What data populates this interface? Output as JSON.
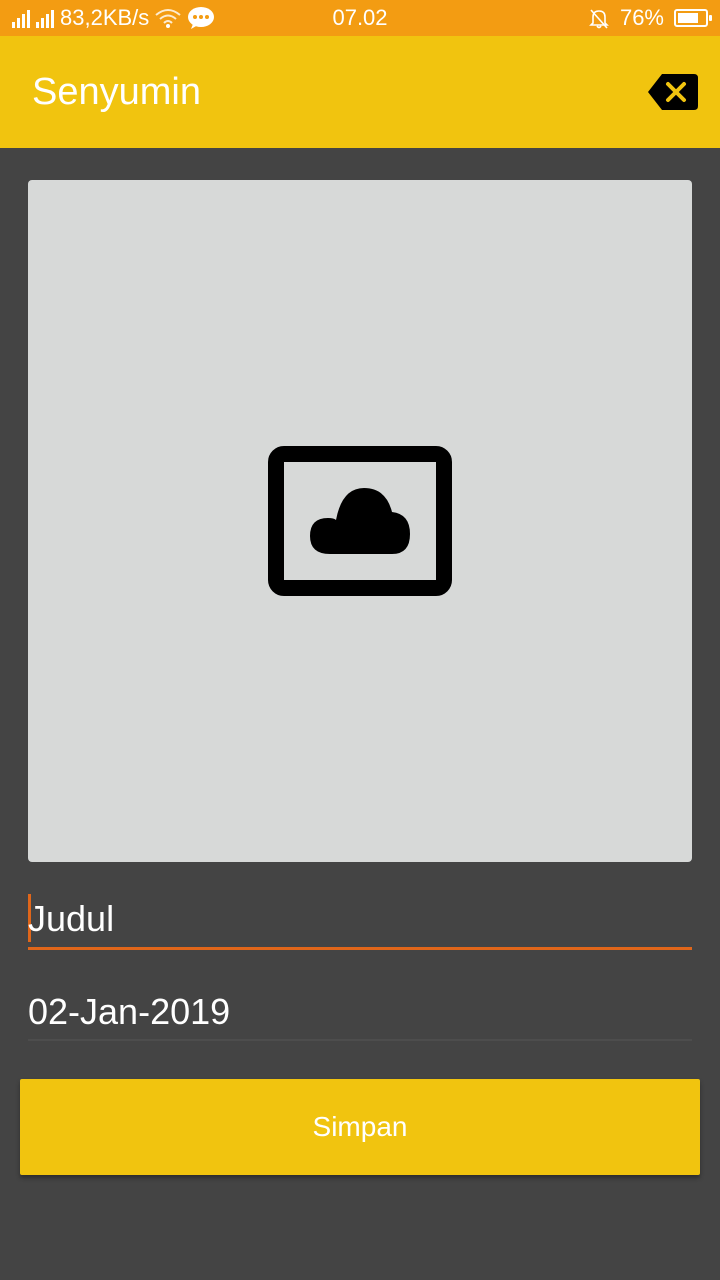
{
  "status_bar": {
    "network_speed": "83,2KB/s",
    "time": "07.02",
    "battery_percent": "76%",
    "battery_level": 0.76
  },
  "app_bar": {
    "title": "Senyumin",
    "clear_icon": "backspace-icon"
  },
  "image_picker": {
    "icon": "image-cloud-icon"
  },
  "form": {
    "title_value": "Judul",
    "date_value": "02-Jan-2019",
    "save_label": "Simpan"
  },
  "colors": {
    "status_bar": "#F39C12",
    "app_bar": "#F1C40F",
    "background": "#444444",
    "image_box": "#D7D9D8",
    "accent": "#E0661A",
    "button": "#F1C40F"
  }
}
